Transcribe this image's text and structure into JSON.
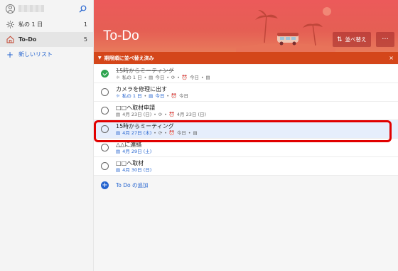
{
  "sidebar": {
    "items": [
      {
        "label": "私の 1 日",
        "count": "1"
      },
      {
        "label": "To-Do",
        "count": "5"
      }
    ],
    "new_list_label": "新しいリスト"
  },
  "header": {
    "title": "To-Do",
    "sort_label": "並べ替え",
    "more_label": "···"
  },
  "banner": {
    "text": "期限順に並べ替え済み",
    "close": "×"
  },
  "tasks": [
    {
      "title": "15時からミーティング",
      "done": true,
      "meta": [
        "私の 1 日",
        "今日",
        "今日"
      ]
    },
    {
      "title": "カメラを修理に出す",
      "done": false,
      "meta": [
        "私の 1 日",
        "今日",
        "今日"
      ]
    },
    {
      "title": "□□へ取材申請",
      "done": false,
      "meta": [
        "4月 23日 (日)",
        "4月 23日 (日)"
      ]
    },
    {
      "title": "15時からミーティング",
      "done": false,
      "meta": [
        "4月 27日 (木)",
        "今日"
      ]
    },
    {
      "title": "△△に連絡",
      "done": false,
      "meta": [
        "4月 29日 (土)"
      ]
    },
    {
      "title": "□□へ取材",
      "done": false,
      "meta": [
        "4月 30日 (日)"
      ]
    }
  ],
  "add_task": {
    "label": "To Do の追加"
  },
  "colors": {
    "accent": "#2564cf",
    "hero": "#ec5a5a",
    "banner": "#d4461a",
    "highlight": "#e10000"
  }
}
